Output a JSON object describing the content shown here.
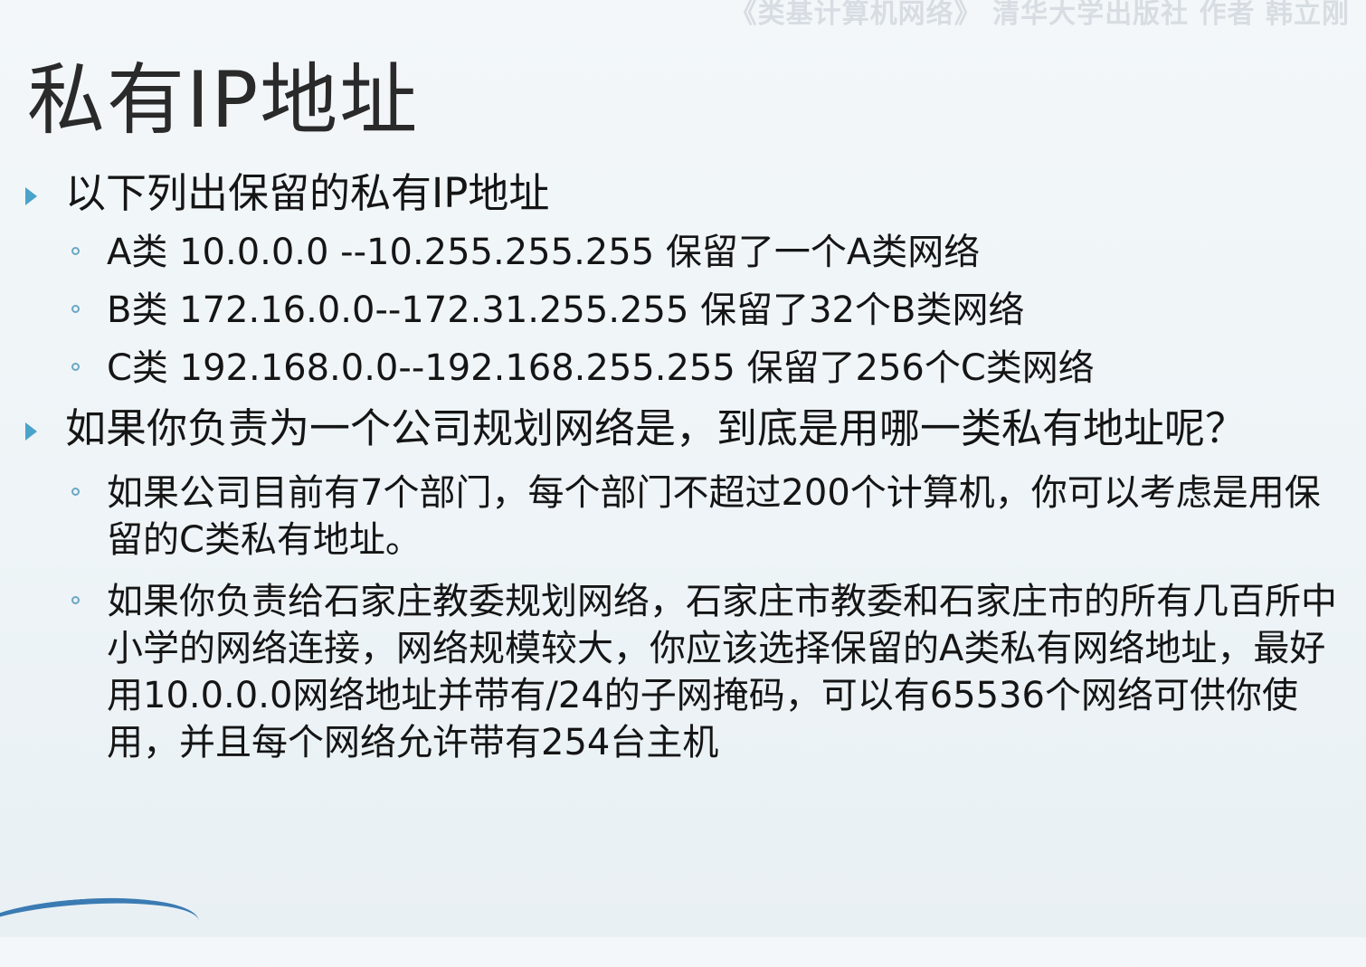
{
  "watermark": "《类基计算机网络》 清华大学出版社 作者 韩立刚",
  "title": "私有IP地址",
  "bullets": [
    {
      "text": "以下列出保留的私有IP地址",
      "subs": [
        "A类 10.0.0.0 --10.255.255.255 保留了一个A类网络",
        "B类 172.16.0.0--172.31.255.255 保留了32个B类网络",
        "C类 192.168.0.0--192.168.255.255 保留了256个C类网络"
      ]
    },
    {
      "text": "如果你负责为一个公司规划网络是，到底是用哪一类私有地址呢？",
      "subs": [
        "如果公司目前有7个部门，每个部门不超过200个计算机，你可以考虑是用保留的C类私有地址。",
        "如果你负责给石家庄教委规划网络，石家庄市教委和石家庄市的所有几百所中小学的网络连接，网络规模较大，你应该选择保留的A类私有网络地址，最好用10.0.0.0网络地址并带有/24的子网掩码，可以有65536个网络可供你使用，并且每个网络允许带有254台主机"
      ]
    }
  ],
  "colors": {
    "bullet_accent": "#4aa3c9",
    "sub_bullet": "#6aa7c4",
    "corner_curve": "#3b7bb3"
  },
  "icons": {
    "level1_bullet": "triangle-bullet-icon",
    "level2_bullet": "circle-bullet-icon"
  }
}
